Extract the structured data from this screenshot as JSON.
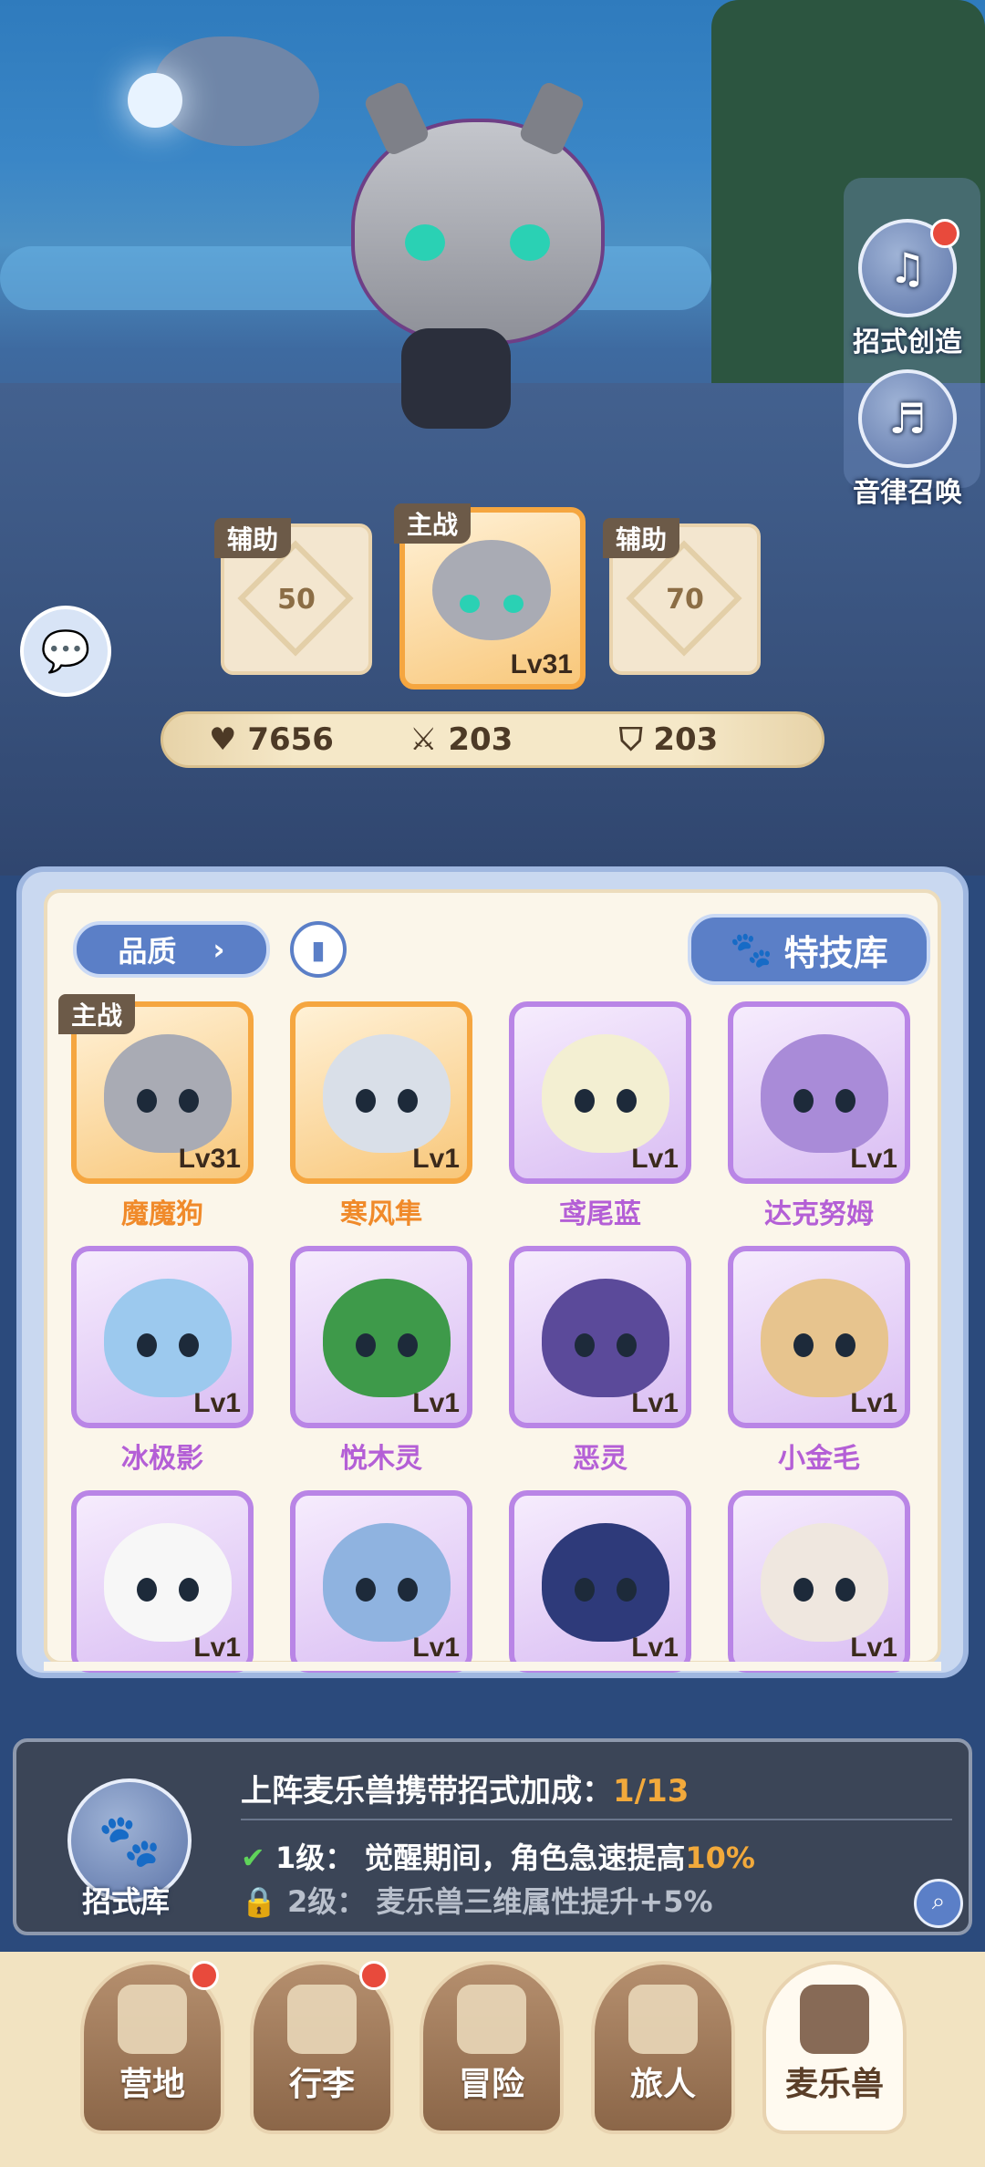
{
  "side_buttons": [
    {
      "label": "招式创造",
      "icon": "book-icon",
      "badge": true
    },
    {
      "label": "音律召唤",
      "icon": "lyre-icon",
      "badge": false
    }
  ],
  "team": {
    "left": {
      "tag": "辅助",
      "value": "50"
    },
    "main": {
      "tag": "主战",
      "level": "Lv31"
    },
    "right": {
      "tag": "辅助",
      "value": "70"
    }
  },
  "stats": {
    "hp": "7656",
    "attack": "203",
    "defense": "203"
  },
  "filter": {
    "quality_label": "品质",
    "skill_library": "特技库"
  },
  "monsters": [
    {
      "name": "魔魔狗",
      "level": "Lv31",
      "tag": "主战",
      "rarity": "orange"
    },
    {
      "name": "寒风隼",
      "level": "Lv1",
      "tag": "",
      "rarity": "orange"
    },
    {
      "name": "鸢尾蓝",
      "level": "Lv1",
      "tag": "",
      "rarity": "purple"
    },
    {
      "name": "达克努姆",
      "level": "Lv1",
      "tag": "",
      "rarity": "purple"
    },
    {
      "name": "冰极影",
      "level": "Lv1",
      "tag": "",
      "rarity": "purple"
    },
    {
      "name": "悦木灵",
      "level": "Lv1",
      "tag": "",
      "rarity": "purple"
    },
    {
      "name": "恶灵",
      "level": "Lv1",
      "tag": "",
      "rarity": "purple"
    },
    {
      "name": "小金毛",
      "level": "Lv1",
      "tag": "",
      "rarity": "purple"
    },
    {
      "name": "",
      "level": "Lv1",
      "tag": "",
      "rarity": "purple"
    },
    {
      "name": "",
      "level": "Lv1",
      "tag": "",
      "rarity": "purple"
    },
    {
      "name": "",
      "level": "Lv1",
      "tag": "",
      "rarity": "purple"
    },
    {
      "name": "",
      "level": "Lv1",
      "tag": "",
      "rarity": "purple"
    }
  ],
  "bonus": {
    "library_label": "招式库",
    "title": "上阵麦乐兽携带招式加成：",
    "progress": "1/13",
    "level1_label": "1级：",
    "level1_text": "觉醒期间，角色急速提高",
    "level1_value": "10%",
    "level2_label": "2级：",
    "level2_text": "麦乐兽三维属性提升+5%"
  },
  "nav": [
    {
      "label": "营地",
      "badge": true
    },
    {
      "label": "行李",
      "badge": true
    },
    {
      "label": "冒险",
      "badge": false
    },
    {
      "label": "旅人",
      "badge": false
    },
    {
      "label": "麦乐兽",
      "badge": false,
      "active": true
    }
  ],
  "colors": {
    "orange_name": "#f08a2a",
    "purple_name": "#b45fd6",
    "gold": "#f2a93b"
  }
}
